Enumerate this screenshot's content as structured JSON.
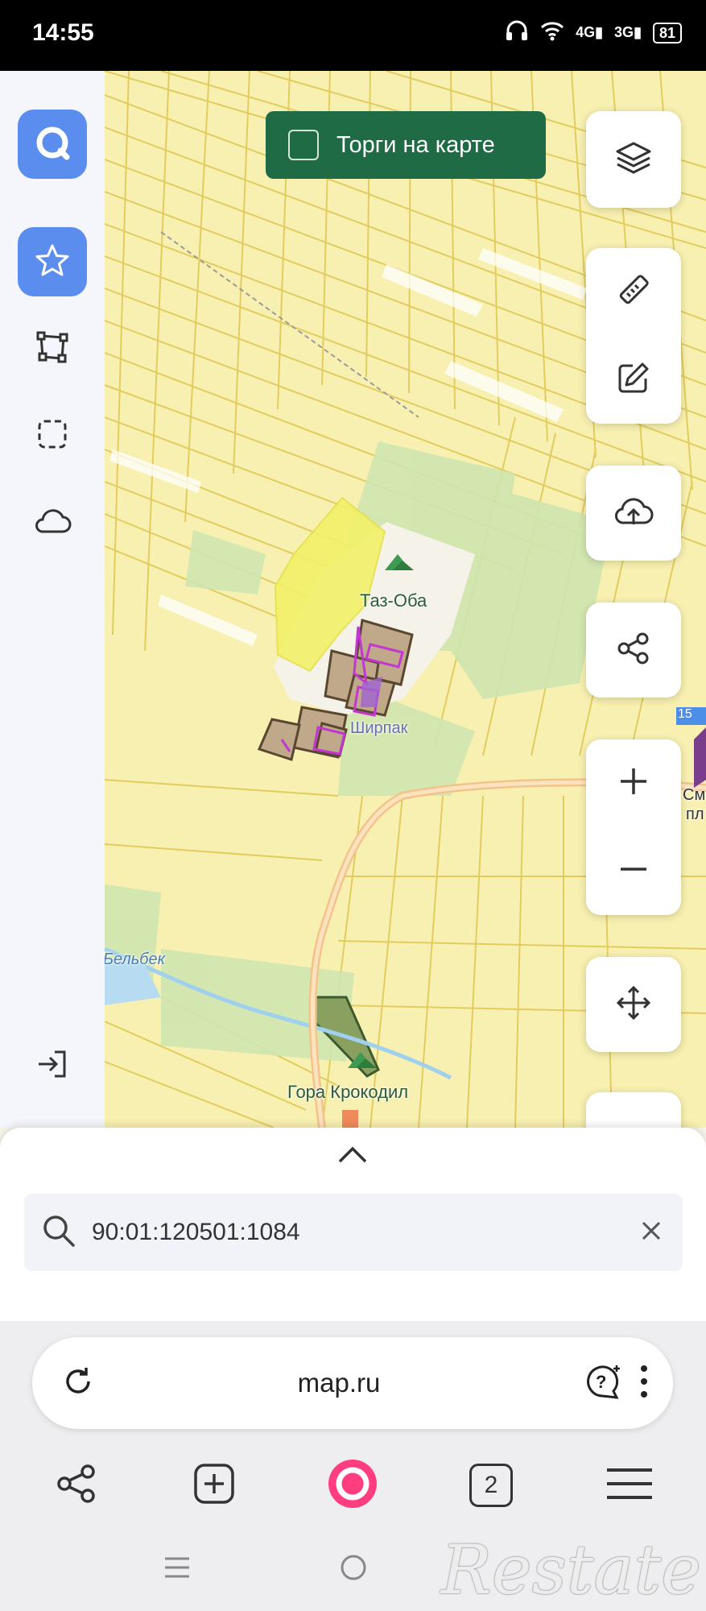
{
  "status_bar": {
    "time": "14:55",
    "net1": "4G",
    "net2": "3G",
    "battery": "81"
  },
  "left_sidebar": {
    "icons": [
      "logo-icon",
      "star-icon",
      "polygon-icon",
      "select-icon",
      "cloud-icon",
      "login-icon"
    ]
  },
  "top_toggle": {
    "label": "Торги на карте",
    "checked": false
  },
  "map_controls": {
    "icons": [
      "layers-icon",
      "ruler-icon",
      "edit-icon",
      "upload-cloud-icon",
      "share-icon",
      "zoom-in-icon",
      "zoom-out-icon",
      "move-icon"
    ]
  },
  "map_labels": {
    "hill1": "Таз-Оба",
    "place": "Ширпак",
    "river": "Бельбек",
    "hill2": "Гора Крокодил",
    "edge1": "15",
    "edge2": "См",
    "edge3": "пл"
  },
  "search": {
    "value": "90:01:120501:1084"
  },
  "browser": {
    "url": "map.ru",
    "tabs_count": "2"
  },
  "watermark": "Restate",
  "colors": {
    "accent_blue": "#5b8def",
    "toggle_green": "#1f6b45",
    "map_yellow": "#f8f0b0",
    "parcel_line": "#e6cf5c",
    "alice_pink": "#ff3d7f"
  }
}
